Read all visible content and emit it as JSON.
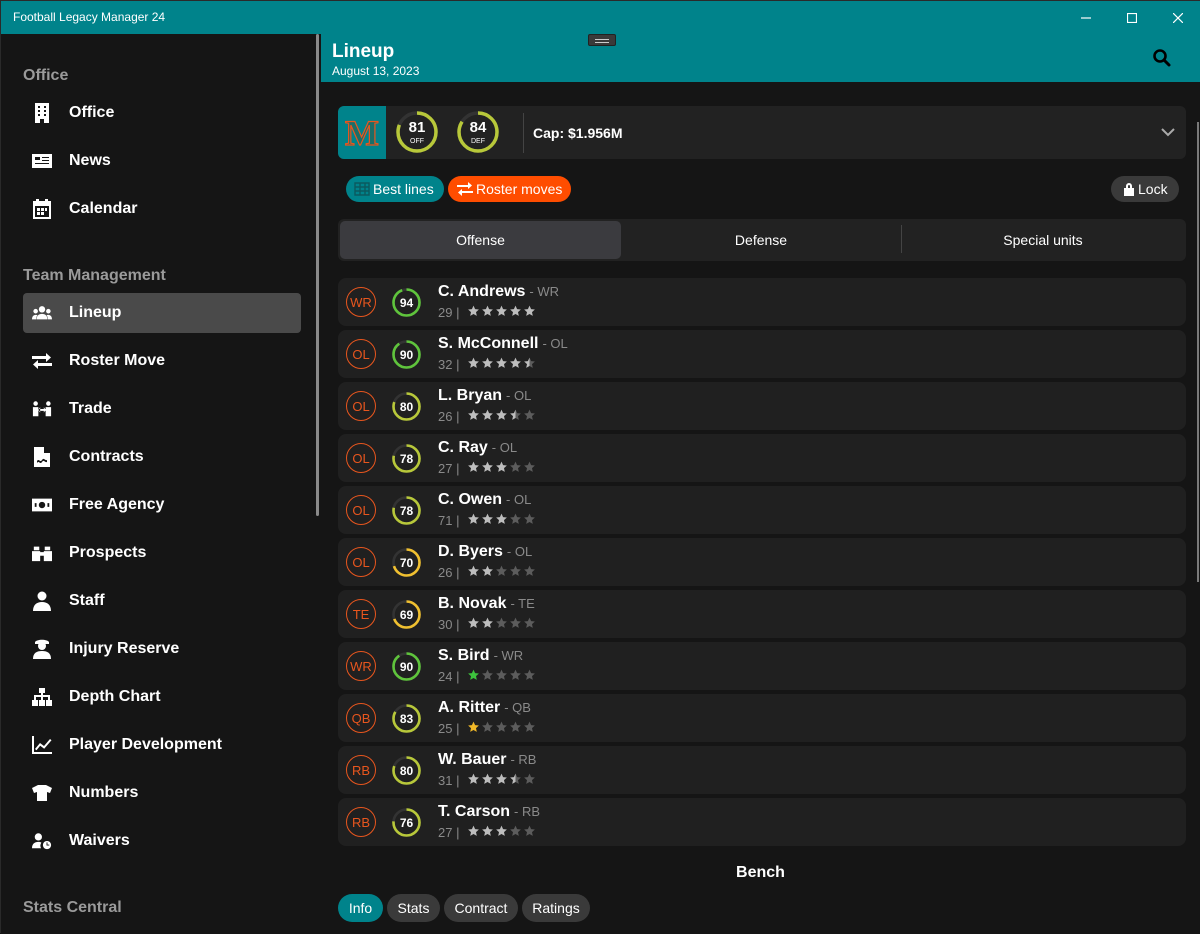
{
  "window": {
    "title": "Football Legacy Manager 24"
  },
  "sidebar": {
    "sections": [
      {
        "title": "Office",
        "items": [
          {
            "label": "Office",
            "icon": "building-icon"
          },
          {
            "label": "News",
            "icon": "newspaper-icon"
          },
          {
            "label": "Calendar",
            "icon": "calendar-icon"
          }
        ]
      },
      {
        "title": "Team Management",
        "items": [
          {
            "label": "Lineup",
            "icon": "users-icon",
            "active": true
          },
          {
            "label": "Roster Move",
            "icon": "swap-icon"
          },
          {
            "label": "Trade",
            "icon": "trade-icon"
          },
          {
            "label": "Contracts",
            "icon": "contract-icon"
          },
          {
            "label": "Free Agency",
            "icon": "money-icon"
          },
          {
            "label": "Prospects",
            "icon": "binoculars-icon"
          },
          {
            "label": "Staff",
            "icon": "staff-icon"
          },
          {
            "label": "Injury Reserve",
            "icon": "injury-icon"
          },
          {
            "label": "Depth Chart",
            "icon": "sitemap-icon"
          },
          {
            "label": "Player Development",
            "icon": "chart-line-icon"
          },
          {
            "label": "Numbers",
            "icon": "jersey-icon"
          },
          {
            "label": "Waivers",
            "icon": "user-clock-icon"
          }
        ]
      },
      {
        "title": "Stats Central",
        "items": []
      }
    ]
  },
  "header": {
    "title": "Lineup",
    "date": "August 13, 2023"
  },
  "team": {
    "logo_letter": "M",
    "off_rating": "81",
    "off_label": "OFF",
    "off_fraction": 0.81,
    "def_rating": "84",
    "def_label": "DEF",
    "def_fraction": 0.84,
    "cap": "Cap: $1.956M"
  },
  "actions": {
    "best_lines": "Best lines",
    "roster_moves": "Roster moves",
    "lock": "Lock"
  },
  "tabs": [
    "Offense",
    "Defense",
    "Special units"
  ],
  "players": [
    {
      "pos": "WR",
      "ovr": "94",
      "name": "C. Andrews",
      "role": "- WR",
      "age": "29 |",
      "stars": 5,
      "star_color": "#bdbdbd"
    },
    {
      "pos": "OL",
      "ovr": "90",
      "name": "S. McConnell",
      "role": "- OL",
      "age": "32 |",
      "stars": 4.5,
      "star_color": "#bdbdbd"
    },
    {
      "pos": "OL",
      "ovr": "80",
      "name": "L. Bryan",
      "role": "- OL",
      "age": "26 |",
      "stars": 3.5,
      "star_color": "#bdbdbd"
    },
    {
      "pos": "OL",
      "ovr": "78",
      "name": "C. Ray",
      "role": "- OL",
      "age": "27 |",
      "stars": 3,
      "star_color": "#bdbdbd"
    },
    {
      "pos": "OL",
      "ovr": "78",
      "name": "C. Owen",
      "role": "- OL",
      "age": "71 |",
      "stars": 3,
      "star_color": "#bdbdbd"
    },
    {
      "pos": "OL",
      "ovr": "70",
      "name": "D. Byers",
      "role": "- OL",
      "age": "26 |",
      "stars": 2,
      "star_color": "#bdbdbd"
    },
    {
      "pos": "TE",
      "ovr": "69",
      "name": "B. Novak",
      "role": "- TE",
      "age": "30 |",
      "stars": 2,
      "star_color": "#bdbdbd"
    },
    {
      "pos": "WR",
      "ovr": "90",
      "name": "S. Bird",
      "role": "- WR",
      "age": "24 |",
      "stars": 1,
      "star_color": "#3cc43c"
    },
    {
      "pos": "QB",
      "ovr": "83",
      "name": "A. Ritter",
      "role": "- QB",
      "age": "25 |",
      "stars": 1,
      "star_color": "#f0b828"
    },
    {
      "pos": "RB",
      "ovr": "80",
      "name": "W. Bauer",
      "role": "- RB",
      "age": "31 |",
      "stars": 3.5,
      "star_color": "#bdbdbd"
    },
    {
      "pos": "RB",
      "ovr": "76",
      "name": "T. Carson",
      "role": "- RB",
      "age": "27 |",
      "stars": 3,
      "star_color": "#bdbdbd"
    }
  ],
  "bench": {
    "title": "Bench",
    "tabs": [
      "Info",
      "Stats",
      "Contract",
      "Ratings"
    ]
  },
  "colors": {
    "accent": "#00838b",
    "orange": "#e8561e",
    "ring_green": "#5fc43c",
    "ring_lime": "#b8c83a",
    "ring_yellow": "#f0c030"
  }
}
